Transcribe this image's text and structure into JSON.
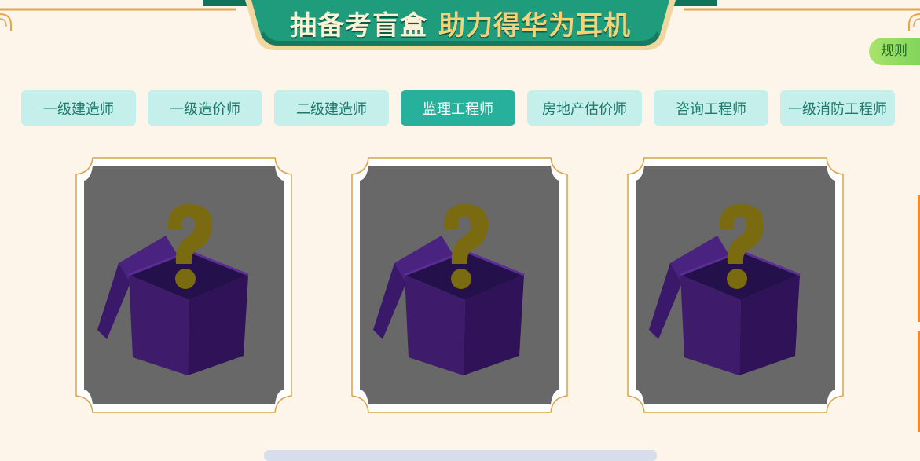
{
  "header": {
    "title_part1": "抽备考盲盒",
    "title_part2": "助力得华为耳机"
  },
  "rules_button": {
    "label": "规则"
  },
  "tabs": [
    {
      "label": "一级建造师",
      "active": false
    },
    {
      "label": "一级造价师",
      "active": false
    },
    {
      "label": "二级建造师",
      "active": false
    },
    {
      "label": "监理工程师",
      "active": true
    },
    {
      "label": "房地产估价师",
      "active": false
    },
    {
      "label": "咨询工程师",
      "active": false
    },
    {
      "label": "一级消防工程师",
      "active": false
    }
  ],
  "blind_boxes": [
    {
      "icon": "mystery-box-icon"
    },
    {
      "icon": "mystery-box-icon"
    },
    {
      "icon": "mystery-box-icon"
    }
  ],
  "colors": {
    "background": "#fdf5ea",
    "banner_green": "#1e9c7c",
    "tab_inactive": "#c5efea",
    "tab_active": "#27b19c",
    "card_border": "#d9a34b",
    "card_inner": "#686868",
    "box_purple": "#3f1b6b",
    "question_mark": "#7a6a10"
  }
}
